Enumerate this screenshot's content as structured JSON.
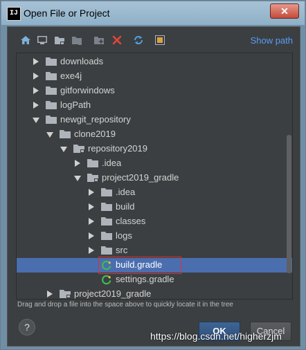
{
  "window": {
    "title": "Open File or Project",
    "app_logo_text": "IJ",
    "close_label": "✕"
  },
  "toolbar": {
    "icons": [
      "home-icon",
      "desktop-icon",
      "project-folder-icon",
      "module-folder-icon",
      "new-folder-icon",
      "delete-icon",
      "refresh-icon",
      "show-hidden-icon"
    ],
    "show_path_label": "Show path"
  },
  "tree": {
    "rows": [
      {
        "label": "downloads",
        "depth": 0,
        "expand": "collapsed",
        "icon": "folder"
      },
      {
        "label": "exe4j",
        "depth": 0,
        "expand": "collapsed",
        "icon": "folder"
      },
      {
        "label": "gitforwindows",
        "depth": 0,
        "expand": "collapsed",
        "icon": "folder"
      },
      {
        "label": "logPath",
        "depth": 0,
        "expand": "collapsed",
        "icon": "folder"
      },
      {
        "label": "newgit_repository",
        "depth": 0,
        "expand": "expanded",
        "icon": "folder"
      },
      {
        "label": "clone2019",
        "depth": 1,
        "expand": "expanded",
        "icon": "folder"
      },
      {
        "label": "repository2019",
        "depth": 2,
        "expand": "expanded",
        "icon": "module-folder"
      },
      {
        "label": ".idea",
        "depth": 3,
        "expand": "collapsed",
        "icon": "folder"
      },
      {
        "label": "project2019_gradle",
        "depth": 3,
        "expand": "expanded",
        "icon": "module-folder"
      },
      {
        "label": ".idea",
        "depth": 4,
        "expand": "collapsed",
        "icon": "folder"
      },
      {
        "label": "build",
        "depth": 4,
        "expand": "collapsed",
        "icon": "folder"
      },
      {
        "label": "classes",
        "depth": 4,
        "expand": "collapsed",
        "icon": "folder"
      },
      {
        "label": "logs",
        "depth": 4,
        "expand": "collapsed",
        "icon": "folder"
      },
      {
        "label": "src",
        "depth": 4,
        "expand": "collapsed",
        "icon": "folder"
      },
      {
        "label": "build.gradle",
        "depth": 4,
        "expand": "none",
        "icon": "gradle",
        "selected": true
      },
      {
        "label": "settings.gradle",
        "depth": 4,
        "expand": "none",
        "icon": "gradle"
      },
      {
        "label": "project2019_gradle",
        "depth": 1,
        "expand": "collapsed",
        "icon": "module-folder"
      }
    ]
  },
  "hint": "Drag and drop a file into the space above to quickly locate it in the tree",
  "buttons": {
    "help": "?",
    "ok": "OK",
    "cancel": "Cancel"
  },
  "watermark": "https://blog.csdn.net/higherzjm",
  "colors": {
    "selection": "#4b6eaf",
    "link": "#589df6",
    "highlight_border": "#e0312e",
    "gradle_green": "#3fb950"
  }
}
